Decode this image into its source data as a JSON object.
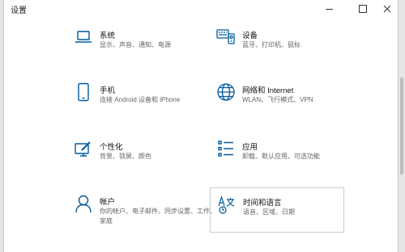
{
  "window": {
    "title": "设置",
    "minimize_label": "",
    "maximize_label": "",
    "close_label": ""
  },
  "tiles": [
    {
      "icon": "laptop-icon",
      "label": "系统",
      "desc": "显示、声音、通知、电源"
    },
    {
      "icon": "keyboard-devices-icon",
      "label": "设备",
      "desc": "蓝牙、打印机、鼠标"
    },
    {
      "icon": "phone-icon",
      "label": "手机",
      "desc": "连接 Android 设备和 iPhone"
    },
    {
      "icon": "globe-icon",
      "label": "网络和 Internet",
      "desc": "WLAN、飞行模式、VPN"
    },
    {
      "icon": "personalization-icon",
      "label": "个性化",
      "desc": "背景、锁屏、颜色"
    },
    {
      "icon": "apps-list-icon",
      "label": "应用",
      "desc": "卸载、默认应用、可选功能"
    },
    {
      "icon": "person-icon",
      "label": "帐户",
      "desc": "你的帐户、电子邮件、同步设置、工作、家庭"
    },
    {
      "icon": "time-language-icon",
      "label": "时间和语言",
      "desc": "语音、区域、日期"
    }
  ],
  "colors": {
    "icon_accent": "#005a9e"
  }
}
